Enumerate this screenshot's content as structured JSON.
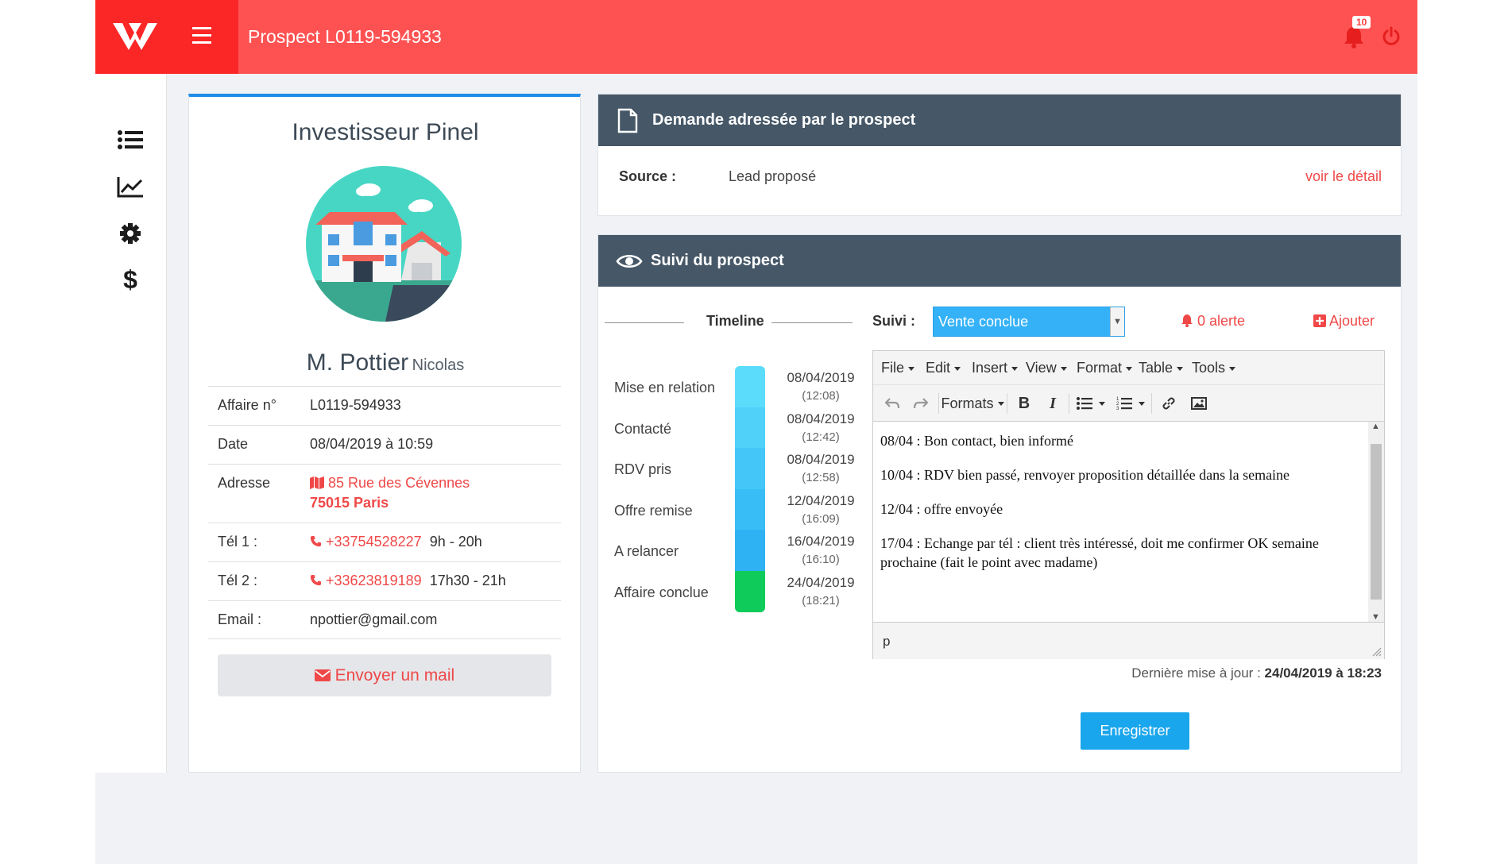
{
  "header": {
    "title": "Prospect L0119-594933",
    "notification_count": "10",
    "logo_icon": "w-logo",
    "menu_icon": "hamburger-icon",
    "bell_icon": "bell-icon",
    "power_icon": "power-icon"
  },
  "sidebar": {
    "items": [
      {
        "icon": "list-icon"
      },
      {
        "icon": "chart-line-icon"
      },
      {
        "icon": "gear-icon"
      },
      {
        "icon": "dollar-icon"
      }
    ]
  },
  "prospect": {
    "title": "Investisseur Pinel",
    "civility_name": "M. Pottier",
    "first_name": "Nicolas",
    "rows": {
      "affaire_label": "Affaire n°",
      "affaire_value": "L0119-594933",
      "date_label": "Date",
      "date_value": "08/04/2019 à 10:59",
      "address_label": "Adresse",
      "address_line1": "85 Rue des Cévennes",
      "address_line2": "75015 Paris",
      "tel1_label": "Tél 1 :",
      "tel1_number": "+33754528227",
      "tel1_hours": "9h - 20h",
      "tel2_label": "Tél 2 :",
      "tel2_number": "+33623819189",
      "tel2_hours": "17h30 - 21h",
      "email_label": "Email :",
      "email_value": "npottier@gmail.com"
    },
    "mail_button": "Envoyer un mail"
  },
  "request": {
    "header": "Demande adressée par le prospect",
    "source_label": "Source :",
    "source_value": "Lead proposé",
    "detail_link": "voir le détail"
  },
  "followup": {
    "header": "Suivi du prospect",
    "timeline_label": "Timeline",
    "suivi_label": "Suivi :",
    "suivi_value": "Vente conclue",
    "alert_link": "0 alerte",
    "add_link": "Ajouter",
    "timeline": [
      {
        "step": "Mise en relation",
        "date": "08/04/2019",
        "time": "(12:08)",
        "color": "#5bdcfb"
      },
      {
        "step": "Contacté",
        "date": "08/04/2019",
        "time": "(12:42)",
        "color": "#4fd1fa"
      },
      {
        "step": "RDV pris",
        "date": "08/04/2019",
        "time": "(12:58)",
        "color": "#44c7f8"
      },
      {
        "step": "Offre remise",
        "date": "12/04/2019",
        "time": "(16:09)",
        "color": "#39bdf6"
      },
      {
        "step": "A relancer",
        "date": "16/04/2019",
        "time": "(16:10)",
        "color": "#2fb2f4"
      },
      {
        "step": "Affaire conclue",
        "date": "24/04/2019",
        "time": "(18:21)",
        "color": "#0fcc5a"
      }
    ],
    "editor": {
      "menus": [
        "File",
        "Edit",
        "Insert",
        "View",
        "Format",
        "Table",
        "Tools"
      ],
      "formats_label": "Formats",
      "lines": [
        "08/04 : Bon contact, bien informé",
        "10/04 : RDV bien passé, renvoyer proposition détaillée dans la semaine",
        "12/04 : offre envoyée",
        "17/04 : Echange par tél : client très intéressé, doit me confirmer OK semaine prochaine (fait le point avec madame)"
      ],
      "status_path": "p"
    },
    "last_update_label": "Dernière mise à jour :",
    "last_update_value": "24/04/2019 à 18:23",
    "save_button": "Enregistrer"
  }
}
